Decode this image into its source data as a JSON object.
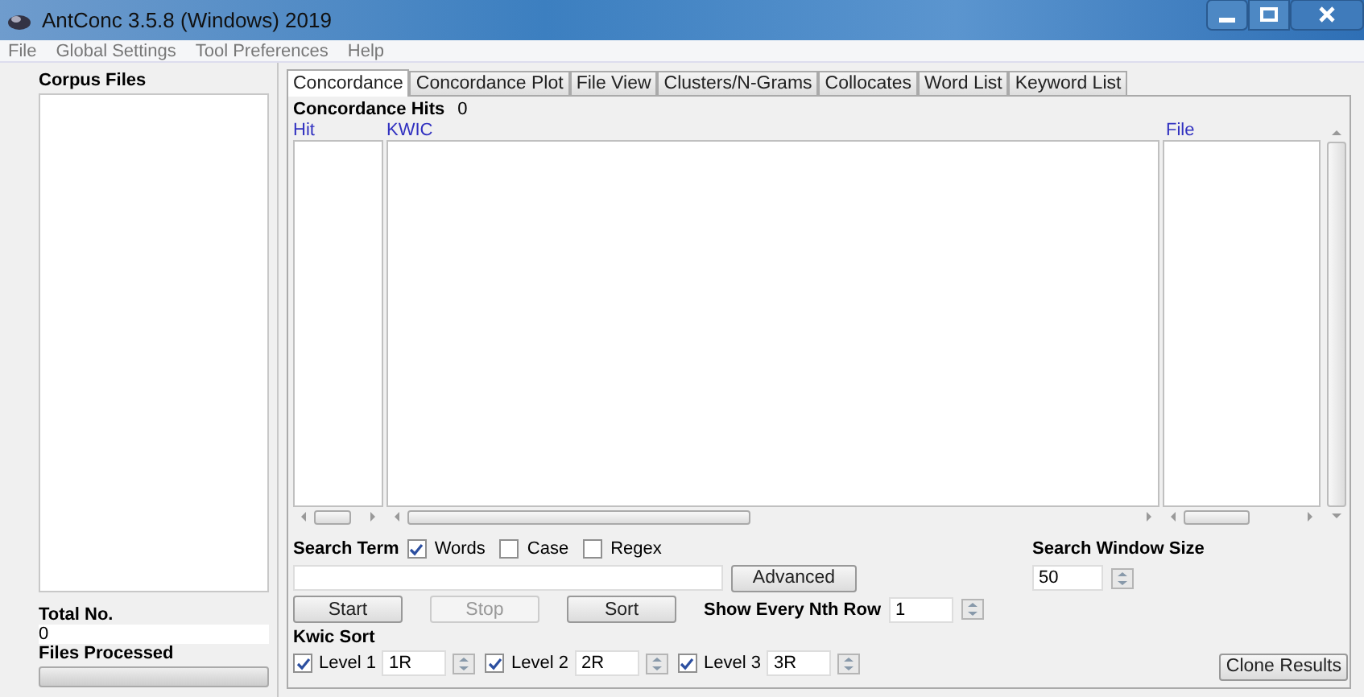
{
  "window": {
    "title": "AntConc 3.5.8 (Windows) 2019"
  },
  "menu": [
    "File",
    "Global Settings",
    "Tool Preferences",
    "Help"
  ],
  "corpus": {
    "heading": "Corpus Files",
    "total_label": "Total No.",
    "total_value": "0",
    "processed_label": "Files Processed",
    "progress": {
      "level": 0
    }
  },
  "tabs": [
    {
      "label": "Concordance",
      "selected": true
    },
    {
      "label": "Concordance Plot",
      "selected": false
    },
    {
      "label": "File View",
      "selected": false
    },
    {
      "label": "Clusters/N-Grams",
      "selected": false
    },
    {
      "label": "Collocates",
      "selected": false
    },
    {
      "label": "Word List",
      "selected": false
    },
    {
      "label": "Keyword List",
      "selected": false
    }
  ],
  "concordance": {
    "hits_label": "Concordance Hits",
    "hits_value": "0",
    "columns": [
      "Hit",
      "KWIC",
      "File"
    ],
    "search_term_label": "Search Term",
    "options": [
      {
        "label": "Words",
        "checked": true
      },
      {
        "label": "Case",
        "checked": false
      },
      {
        "label": "Regex",
        "checked": false
      }
    ],
    "advanced_button": "Advanced",
    "window_size_label": "Search Window Size",
    "window_size": "50",
    "buttons": [
      {
        "label": "Start",
        "disabled": false
      },
      {
        "label": "Stop",
        "disabled": true
      },
      {
        "label": "Sort",
        "disabled": false
      }
    ],
    "nth_row_label": "Show Every Nth Row",
    "nth_row": "1",
    "kwic_sort_label": "Kwic Sort",
    "levels": [
      {
        "label": "Level 1",
        "checked": true,
        "value": "1R"
      },
      {
        "label": "Level 2",
        "checked": true,
        "value": "2R"
      },
      {
        "label": "Level 3",
        "checked": true,
        "value": "3R"
      }
    ],
    "clone_button": "Clone Results"
  }
}
